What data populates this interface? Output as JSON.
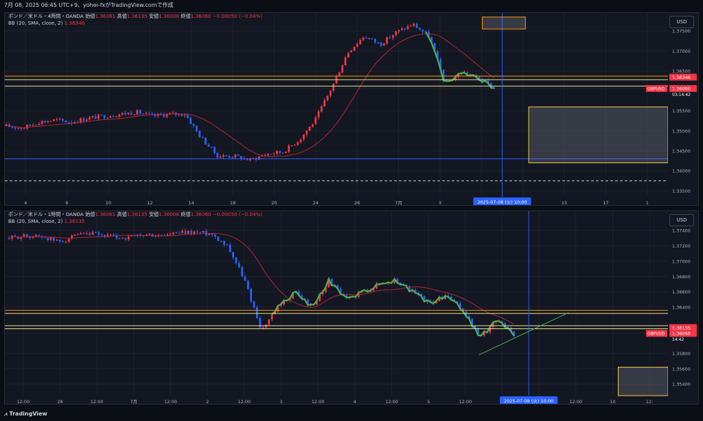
{
  "header": {
    "caption": "7月 08, 2025 06:45 UTC+9、yohei-fxがTradingView.comで作成"
  },
  "footer": {
    "brand": "TradingView"
  },
  "colors": {
    "bg": "#131722",
    "up": "#f23645",
    "down": "#2962ff",
    "bb": "#b22833",
    "wave": "#4caf50",
    "hline": "#f0e68c",
    "box": "#f7c948",
    "grid": "#1e2230",
    "orange": "#ff9800"
  },
  "panels": [
    {
      "symbol": "ポンド／米ドル・4時間・OANDA",
      "open_label": "始値",
      "open": "1.36061",
      "high_label": "高値",
      "high": "1.36135",
      "low_label": "安値",
      "low": "1.36008",
      "close_label": "終値",
      "close": "1.36060",
      "change": "−0.00050 (−0.04%)",
      "indicator": "BB (20, SMA, close, 2)",
      "indicator_value": "1.36346",
      "currency_button": "USD",
      "ticker_tag": "GBPUSD",
      "countdown": "03:14:42",
      "crosshair_label": "2025-07-08 (火)   10:00",
      "chart_data": {
        "type": "candlestick",
        "y_ticks": [
          "1.37500",
          "1.37000",
          "1.36500",
          "1.36346",
          "1.36060",
          "1.35500",
          "1.35000",
          "1.34500",
          "1.34000",
          "1.33500"
        ],
        "ylim": [
          1.3335,
          1.3795
        ],
        "x_ticks": [
          "4",
          "6",
          "10",
          "12",
          "14",
          "18",
          "20",
          "24",
          "26",
          "7月",
          "3",
          "",
          "11",
          "15",
          "17",
          "1"
        ],
        "price_labels": {
          "bb": "1.36346",
          "last": "1.36060"
        },
        "hlines": [
          1.3637,
          1.3628,
          1.3612,
          1.343,
          1.3375
        ],
        "series": [
          {
            "name": "GBPUSD",
            "start": 1.3512,
            "trend": [
              0,
              -0.0005,
              0.001,
              0.0015,
              0.001,
              0.002,
              0.0025,
              0.003,
              0.0035,
              0.0025,
              0.003,
              0.003,
              -0.003,
              -0.0075,
              -0.0075,
              -0.0085,
              -0.007,
              -0.0065,
              -0.0035,
              0.0015,
              0.0095,
              0.0185,
              0.0225,
              0.0205,
              0.0235,
              0.0255,
              0.0225,
              0.0105,
              0.0135,
              0.012,
              0.0095
            ],
            "count": 165
          }
        ]
      }
    },
    {
      "symbol": "ポンド／米ドル・1時間・OANDA",
      "open_label": "始値",
      "open": "1.36061",
      "high_label": "高値",
      "high": "1.36135",
      "low_label": "安値",
      "low": "1.36008",
      "close_label": "終値",
      "close": "1.36060",
      "change": "−0.00050 (−0.04%)",
      "indicator": "BB (20, SMA, close, 2)",
      "indicator_value": "1.36135",
      "currency_button": "USD",
      "ticker_tag": "GBPUSD",
      "countdown": "14:42",
      "crosshair_label": "2025-07-08 (火)   10:00",
      "chart_data": {
        "type": "candlestick",
        "y_ticks": [
          "1.37400",
          "1.37200",
          "1.37000",
          "1.36800",
          "1.36600",
          "1.36400",
          "1.36135",
          "1.36060",
          "1.35800",
          "1.35600",
          "1.35400"
        ],
        "ylim": [
          1.3525,
          1.3765
        ],
        "x_ticks": [
          "12:00",
          "28",
          "12:00",
          "7月",
          "12:00",
          "2",
          "12:00",
          "3",
          "12:00",
          "4",
          "12:00",
          "5",
          "12:00",
          "",
          "9",
          "12:00",
          "10",
          "12:"
        ],
        "price_labels": {
          "bb": "1.36135",
          "last": "1.36060"
        },
        "hlines": [
          1.3636,
          1.3632,
          1.3616,
          1.3612
        ],
        "series": [
          {
            "name": "GBPUSD",
            "start": 1.373,
            "trend": [
              0,
              0.0003,
              0.0002,
              -0.0005,
              0.0003,
              0.0005,
              0.0002,
              0.0,
              0.0004,
              0.0003,
              0.0006,
              0.0008,
              0.0006,
              -0.001,
              -0.0055,
              -0.012,
              -0.009,
              -0.007,
              -0.009,
              -0.0055,
              -0.008,
              -0.007,
              -0.006,
              -0.0055,
              -0.007,
              -0.0085,
              -0.0075,
              -0.0095,
              -0.013,
              -0.0105,
              -0.0125
            ],
            "count": 170
          }
        ]
      }
    }
  ]
}
